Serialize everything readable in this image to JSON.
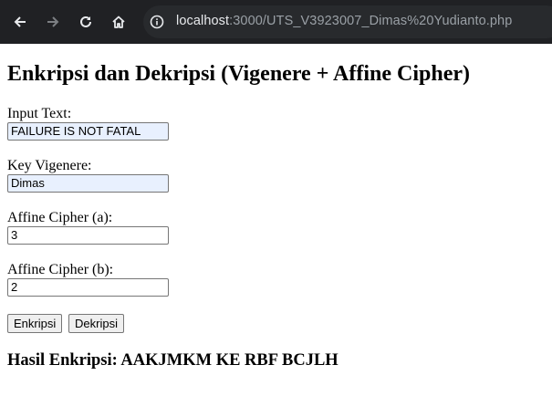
{
  "browser": {
    "url_host": "localhost",
    "url_path": ":3000/UTS_V3923007_Dimas%20Yudianto.php",
    "icons": [
      "back-arrow-icon",
      "forward-arrow-icon",
      "reload-icon",
      "home-icon",
      "site-info-icon"
    ],
    "colors": {
      "toolbar": "#202124",
      "omnibox": "#282a2d",
      "host_text": "#e8eaed",
      "path_text": "#9aa0a6"
    }
  },
  "page": {
    "title": "Enkripsi dan Dekripsi (Vigenere + Affine Cipher)",
    "form": {
      "input_text": {
        "label": "Input Text:",
        "value": "FAILURE IS NOT FATAL"
      },
      "key_vigenere": {
        "label": "Key Vigenere:",
        "value": "Dimas"
      },
      "affine_a": {
        "label": "Affine Cipher (a):",
        "value": "3"
      },
      "affine_b": {
        "label": "Affine Cipher (b):",
        "value": "2"
      },
      "encrypt_label": "Enkripsi",
      "decrypt_label": "Dekripsi"
    },
    "result": "Hasil Enkripsi: AAKJMKM KE RBF BCJLH",
    "colors": {
      "autofill_bg": "#e8f0fe",
      "button_bg": "#efefef"
    }
  }
}
